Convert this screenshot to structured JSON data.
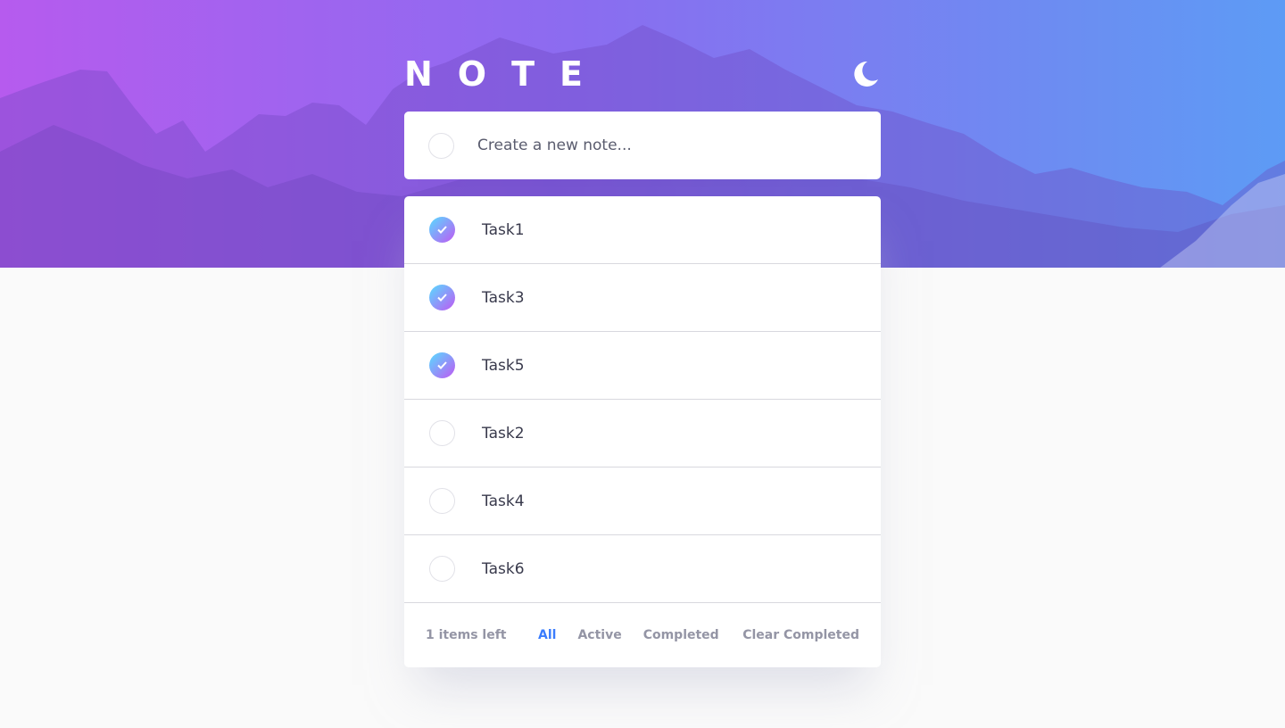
{
  "app": {
    "title": "NOTE"
  },
  "theme": {
    "icon": "moon-icon"
  },
  "new_note": {
    "placeholder": "Create a new note...",
    "value": ""
  },
  "tasks": [
    {
      "label": "Task1",
      "completed": true
    },
    {
      "label": "Task3",
      "completed": true
    },
    {
      "label": "Task5",
      "completed": true
    },
    {
      "label": "Task2",
      "completed": false
    },
    {
      "label": "Task4",
      "completed": false
    },
    {
      "label": "Task6",
      "completed": false
    }
  ],
  "footer": {
    "items_left": "1 items left",
    "filters": [
      "All",
      "Active",
      "Completed"
    ],
    "active_filter": "All",
    "clear_label": "Clear Completed"
  },
  "colors": {
    "accent": "#3a7cfd",
    "check_gradient_start": "#57ddff",
    "check_gradient_end": "#c058f3",
    "text": "#393a4c",
    "muted": "#9495a5"
  }
}
